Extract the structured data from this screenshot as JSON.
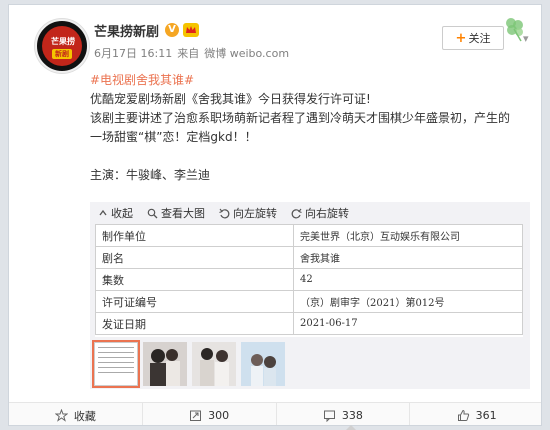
{
  "author": {
    "name": "芒果捞新剧",
    "avatar_top": "芒果捞",
    "avatar_bottom": "新剧"
  },
  "meta": {
    "time": "6月17日 16:11",
    "via": "来自",
    "source": "微博 weibo.com"
  },
  "follow": {
    "label": "关注"
  },
  "post": {
    "tag": "#电视剧舍我其谁#",
    "line1": "优酷宠爱剧场新剧《舍我其谁》今日获得发行许可证!",
    "line2": "该剧主要讲述了治愈系职场萌新记者程了遇到冷萌天才围棋少年盛景初，产生的",
    "line3": "一场甜蜜“棋”恋！定档gkd！！",
    "line4": "主演：牛骏峰、李兰迪"
  },
  "image_toolbar": {
    "collapse": "收起",
    "view_large": "查看大图",
    "rotate_left": "向左旋转",
    "rotate_right": "向右旋转"
  },
  "document_rows": [
    {
      "key": "制作单位",
      "value": "完美世界（北京）互动娱乐有限公司"
    },
    {
      "key": "剧名",
      "value": "舍我其谁"
    },
    {
      "key": "集数",
      "value": "42"
    },
    {
      "key": "许可证编号",
      "value": "（京）剧审字（2021）第012号"
    },
    {
      "key": "发证日期",
      "value": "2021-06-17"
    }
  ],
  "thumb_text": {
    "l1": "完美世界（北京）",
    "l2": "舍我其谁",
    "l3": "42",
    "l4": "（京）剧审字",
    "l5": "2021-06-17"
  },
  "footer": {
    "favorite": "收藏",
    "repost": "300",
    "comment": "338",
    "like": "361"
  },
  "colors": {
    "accent": "#eb7350",
    "brand_orange": "#ff8200",
    "avatar_red": "#c2261a"
  }
}
